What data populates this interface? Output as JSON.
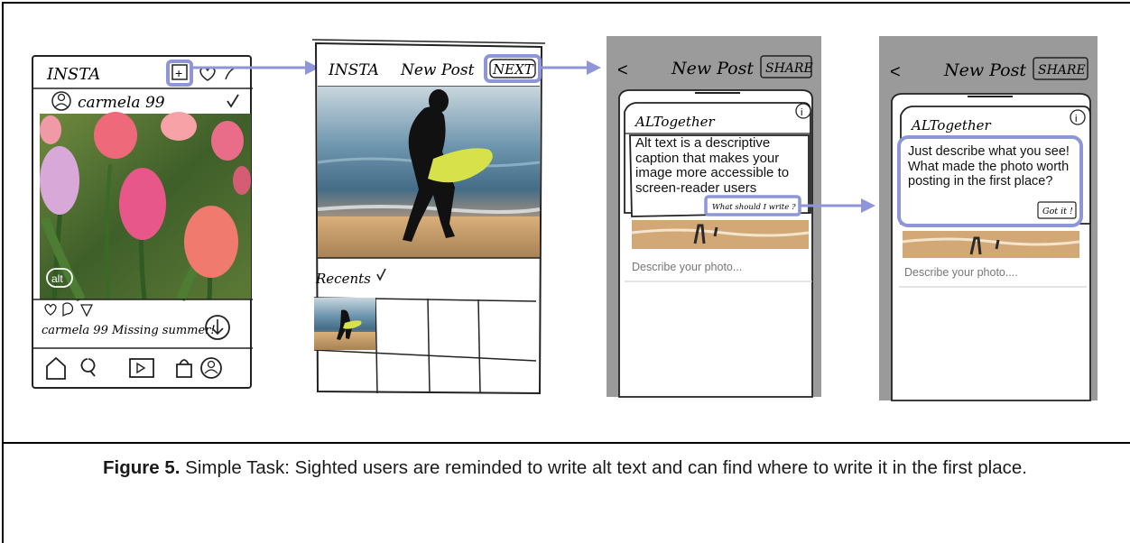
{
  "caption": {
    "label": "Figure 5.",
    "text": "Simple Task: Sighted users are  reminded to write alt text and can find where to write it in the first place."
  },
  "screen1": {
    "app_name": "INSTA",
    "username": "carmela 99",
    "alt_badge": "alt",
    "post_caption": "carmela 99  Missing summer!",
    "icons": [
      "add-post-icon",
      "heart-icon",
      "messages-icon",
      "avatar-icon",
      "check-icon",
      "like-icon",
      "comment-icon",
      "share-icon",
      "download-icon",
      "home-icon",
      "search-icon",
      "reels-icon",
      "shop-icon",
      "profile-icon"
    ]
  },
  "screen2": {
    "app_name": "INSTA",
    "title": "New Post",
    "next_label": "NEXT",
    "recents_label": "Recents",
    "icons": [
      "check-icon"
    ]
  },
  "screen3": {
    "back": "<",
    "title": "New Post",
    "share_label": "SHARE",
    "card_title": "ALTogether",
    "info_text": "Alt text is a descriptive caption that makes your image more accessible to screen-reader users",
    "help_link": "What should I write ?",
    "describe_placeholder": "Describe your photo..."
  },
  "screen4": {
    "back": "<",
    "title": "New Post",
    "share_label": "SHARE",
    "card_title": "ALTogether",
    "info_text": "Just describe what you see! What made the photo worth posting in the first place?",
    "got_it": "Got it !",
    "describe_placeholder": "Describe your photo...."
  },
  "colors": {
    "highlight": "#8f96d8",
    "phone_gray": "#9a9a9a",
    "tulip_pink": "#e8578a",
    "sea_blue": "#4f7a9a",
    "sunset_gold": "#d9a15a"
  }
}
